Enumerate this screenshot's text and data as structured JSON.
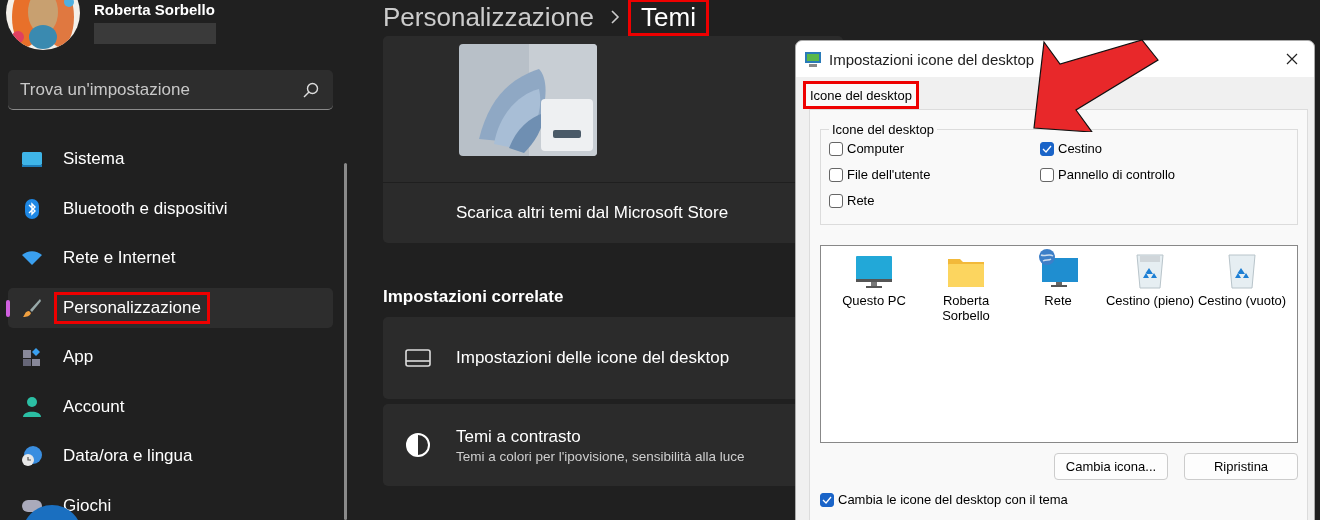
{
  "user": {
    "name": "Roberta Sorbello"
  },
  "search": {
    "placeholder": "Trova un'impostazione"
  },
  "sidebar": {
    "items": [
      {
        "label": "Sistema",
        "selected": false,
        "highlighted": false
      },
      {
        "label": "Bluetooth e dispositivi",
        "selected": false,
        "highlighted": false
      },
      {
        "label": "Rete e Internet",
        "selected": false,
        "highlighted": false
      },
      {
        "label": "Personalizzazione",
        "selected": true,
        "highlighted": true
      },
      {
        "label": "App",
        "selected": false,
        "highlighted": false
      },
      {
        "label": "Account",
        "selected": false,
        "highlighted": false
      },
      {
        "label": "Data/ora e lingua",
        "selected": false,
        "highlighted": false
      },
      {
        "label": "Giochi",
        "selected": false,
        "highlighted": false
      }
    ]
  },
  "breadcrumb": [
    {
      "label": "Personalizzazione",
      "highlighted": false
    },
    {
      "label": "Temi",
      "highlighted": true
    }
  ],
  "themes": {
    "store_link": "Scarica altri temi dal Microsoft Store"
  },
  "related": {
    "heading": "Impostazioni correlate",
    "items": [
      {
        "title": "Impostazioni delle icone del desktop"
      },
      {
        "title": "Temi a contrasto",
        "subtitle": "Temi a colori per l'ipovisione, sensibilità alla luce"
      }
    ]
  },
  "dialog": {
    "title": "Impostazioni icone del desktop",
    "tabs": [
      {
        "label": "Icone del desktop",
        "selected": true,
        "highlighted": true
      }
    ],
    "group": {
      "legend": "Icone del desktop",
      "checkboxes": [
        {
          "label": "Computer",
          "checked": false
        },
        {
          "label": "Cestino",
          "checked": true
        },
        {
          "label": "File dell'utente",
          "checked": false
        },
        {
          "label": "Pannello di controllo",
          "checked": false
        },
        {
          "label": "Rete",
          "checked": false
        }
      ]
    },
    "icons": [
      {
        "label": "Questo PC"
      },
      {
        "label": "Roberta Sorbello"
      },
      {
        "label": "Rete"
      },
      {
        "label": "Cestino (pieno)"
      },
      {
        "label": "Cestino (vuoto)"
      }
    ],
    "buttons": [
      "Cambia icona...",
      "Ripristina"
    ],
    "theme_checkbox": {
      "label": "Cambia le icone del desktop con il tema",
      "checked": true
    }
  }
}
